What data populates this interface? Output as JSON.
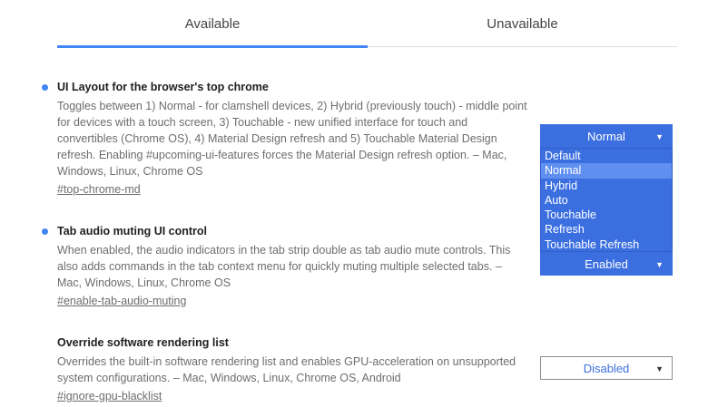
{
  "tabs": {
    "available": "Available",
    "unavailable": "Unavailable"
  },
  "experiments": [
    {
      "title": "UI Layout for the browser's top chrome",
      "description": "Toggles between 1) Normal - for clamshell devices, 2) Hybrid (previously touch) - middle point for devices with a touch screen, 3) Touchable - new unified interface for touch and convertibles (Chrome OS), 4) Material Design refresh and 5) Touchable Material Design refresh. Enabling #upcoming-ui-features forces the Material Design refresh option. – Mac, Windows, Linux, Chrome OS",
      "link": "#top-chrome-md",
      "select_value": "Normal",
      "options": [
        "Default",
        "Normal",
        "Hybrid",
        "Auto",
        "Touchable",
        "Refresh",
        "Touchable Refresh"
      ],
      "selected_option": "Normal"
    },
    {
      "title": "Tab audio muting UI control",
      "description": "When enabled, the audio indicators in the tab strip double as tab audio mute controls. This also adds commands in the tab context menu for quickly muting multiple selected tabs. – Mac, Windows, Linux, Chrome OS",
      "link": "#enable-tab-audio-muting",
      "select_value": "Enabled"
    },
    {
      "title": "Override software rendering list",
      "description": "Overrides the built-in software rendering list and enables GPU-acceleration on unsupported system configurations. – Mac, Windows, Linux, Chrome OS, Android",
      "link": "#ignore-gpu-blacklist",
      "select_value": "Disabled"
    }
  ],
  "colors": {
    "accent": "#4285f4",
    "select_bg": "#3b6fe0",
    "option_highlight": "#5f8ff0"
  },
  "icons": {
    "dropdown_arrow": "chevron-down-icon",
    "bullet": "modified-dot-icon"
  }
}
